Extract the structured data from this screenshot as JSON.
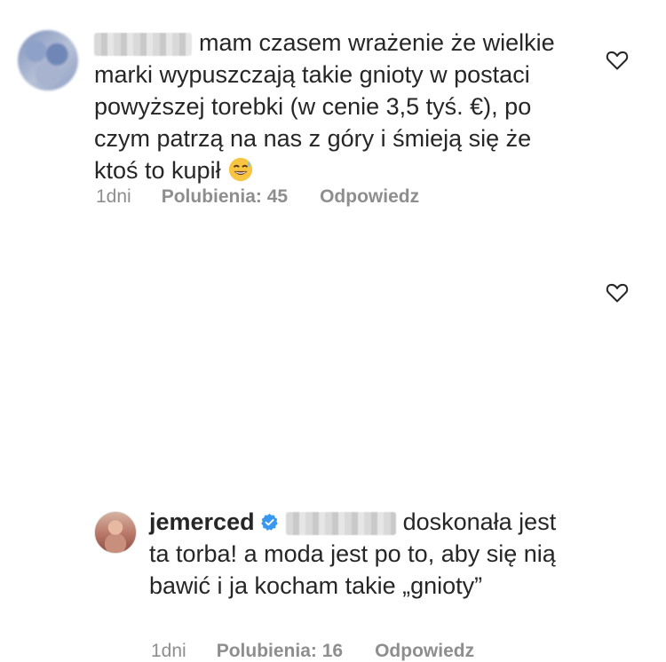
{
  "comments": [
    {
      "text": "mam czasem wrażenie że wielkie marki wypuszczają takie gnioty w postaci powyższej torebki (w cenie 3,5 tyś. €), po czym patrzą na nas z góry i śmieją się że ktoś to kupił",
      "emoji": "sweat-smile-emoji",
      "time": "1dni",
      "likes": "Polubienia: 45",
      "reply": "Odpowiedz"
    },
    {
      "username": "jemerced",
      "text": "doskonała jest ta torba! a moda jest po to, aby się nią bawić i ja kocham takie „gnioty”",
      "time": "1dni",
      "likes": "Polubienia: 16",
      "reply": "Odpowiedz"
    }
  ],
  "colors": {
    "text": "#262626",
    "meta": "#8e8e8e",
    "verified": "#3897f0"
  }
}
